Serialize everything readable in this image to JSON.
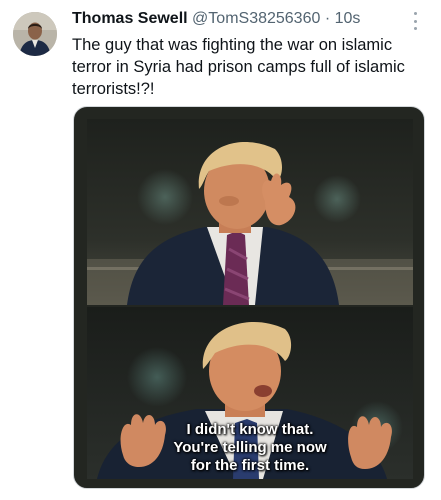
{
  "tweet": {
    "author_name": "Thomas Sewell",
    "author_handle": "@TomS38256360",
    "separator": "·",
    "time": "10s",
    "text": "The guy that was fighting the war on islamic terror in Syria had prison camps full of islamic terrorists!?!"
  },
  "media": {
    "caption_lines": [
      "I didn't know that.",
      "You're telling me now",
      "for the first time."
    ]
  },
  "icons": {
    "more": "more-options-icon",
    "avatar": "avatar-image"
  }
}
